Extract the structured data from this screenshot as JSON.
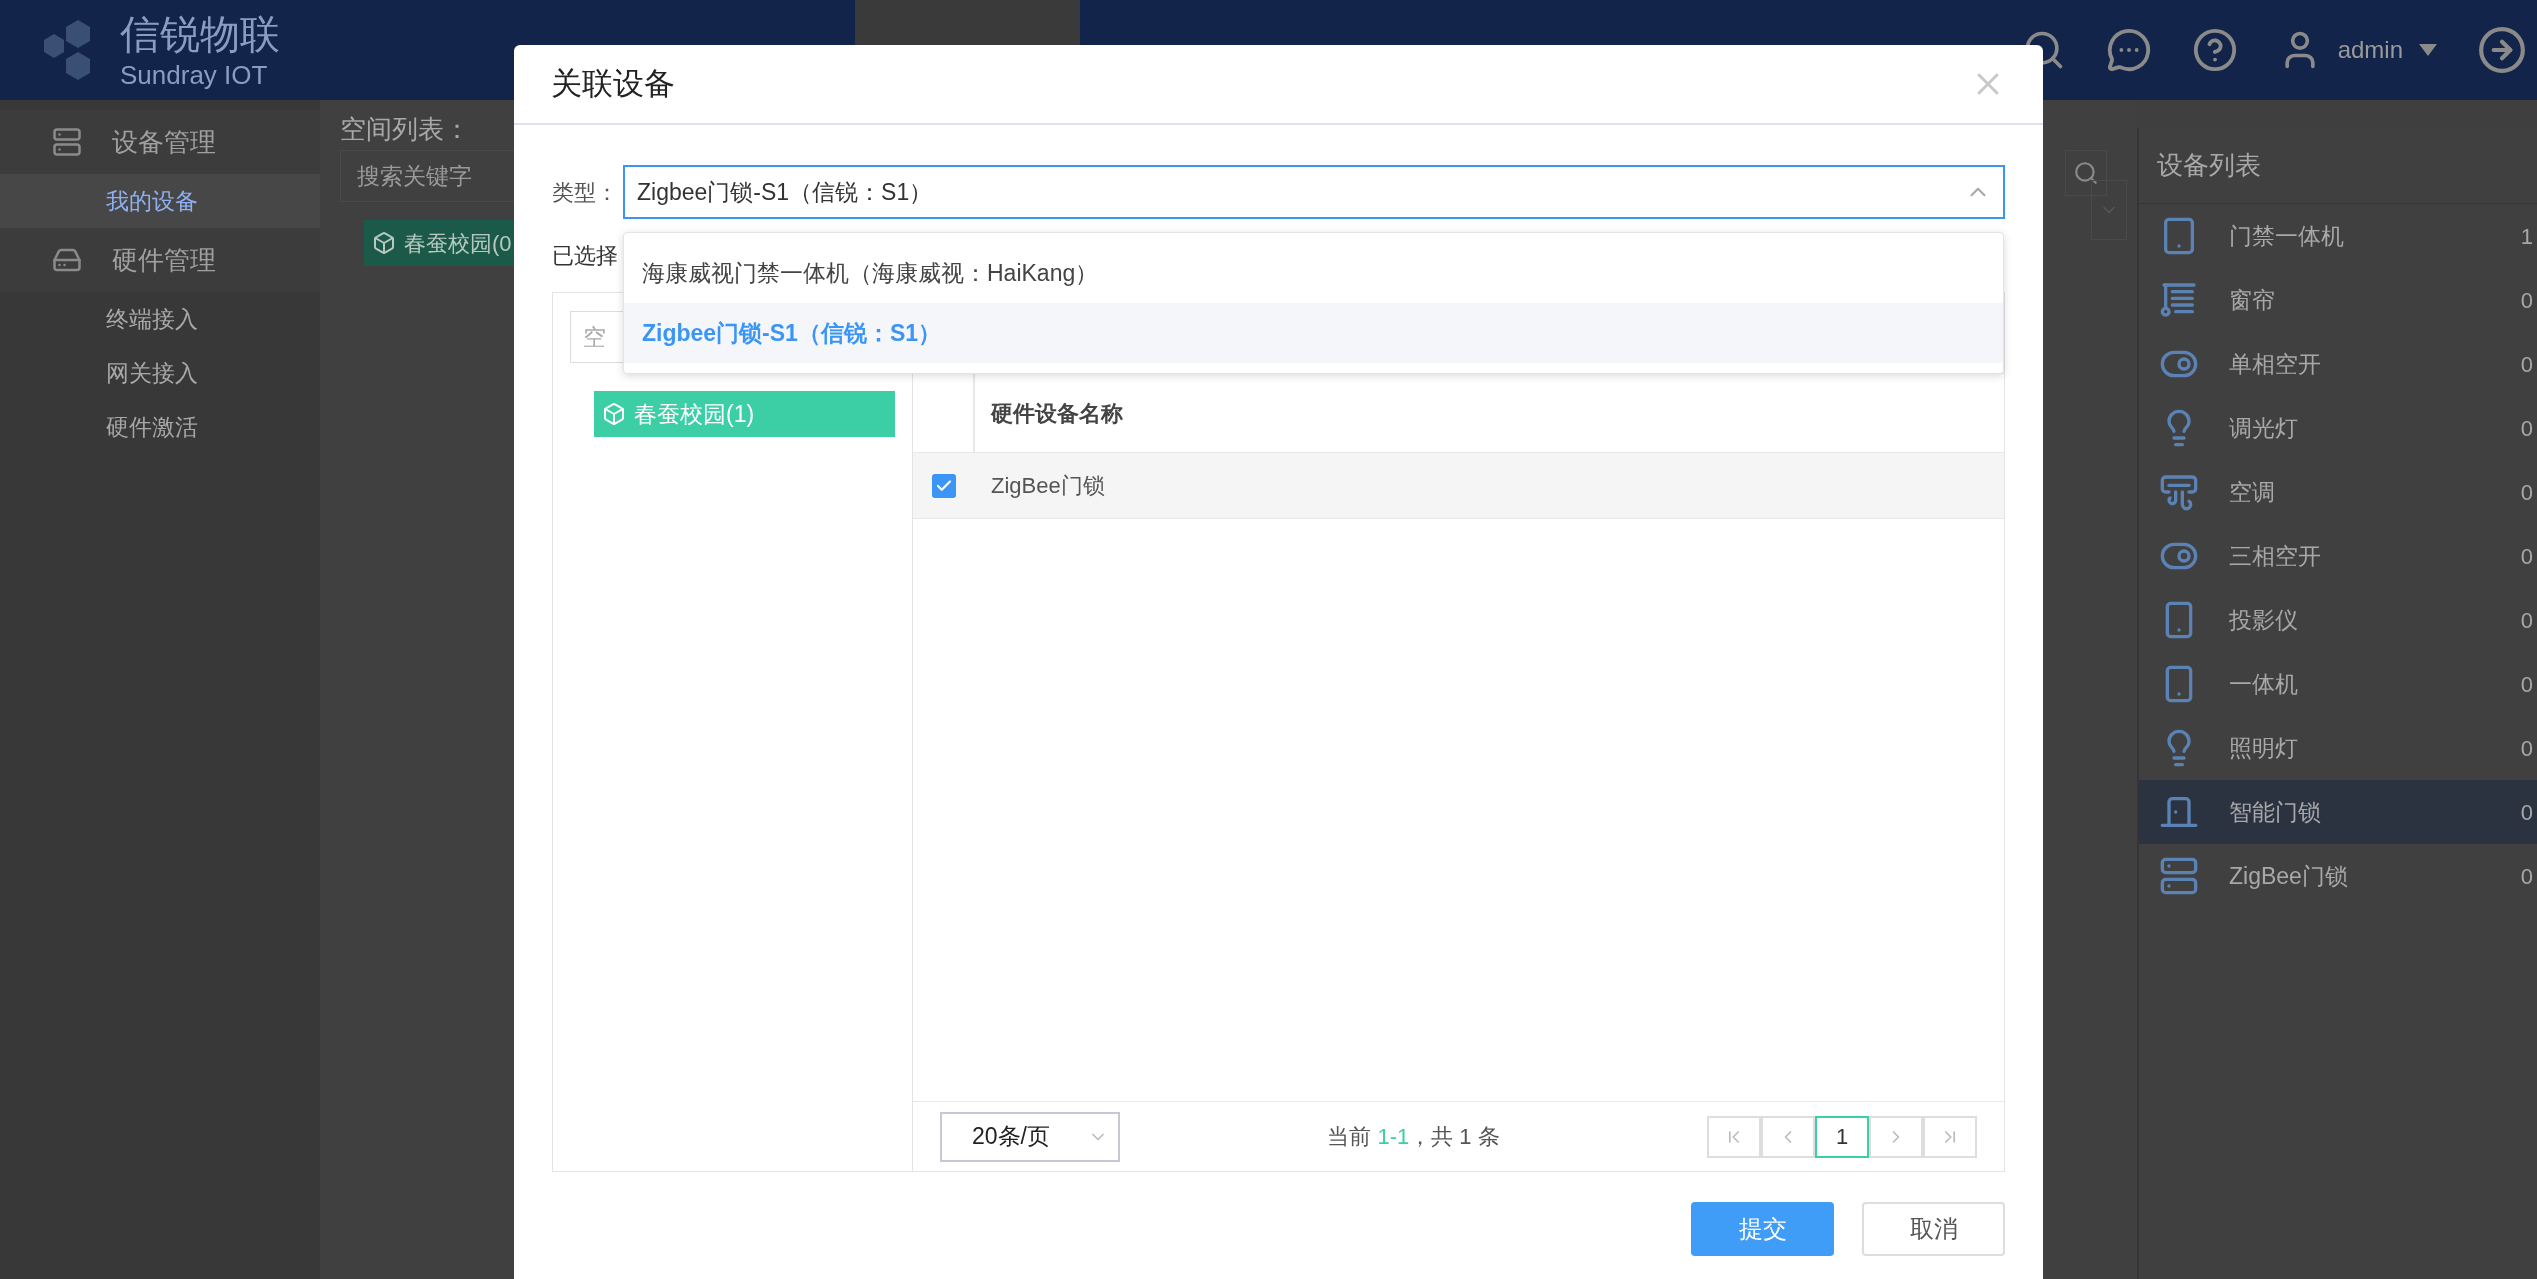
{
  "header": {
    "logo_title": "信锐物联",
    "logo_subtitle": "Sundray IOT",
    "user": "admin"
  },
  "sidebar": {
    "groups": [
      {
        "label": "设备管理",
        "kind": "devices",
        "items": [
          {
            "label": "我的设备",
            "selected": true
          }
        ]
      },
      {
        "label": "硬件管理",
        "kind": "hardware",
        "items": [
          {
            "label": "终端接入",
            "selected": false
          },
          {
            "label": "网关接入",
            "selected": false
          },
          {
            "label": "硬件激活",
            "selected": false
          }
        ]
      }
    ]
  },
  "space_panel": {
    "title": "空间列表：",
    "search": {
      "placeholder": "搜索关键字"
    },
    "node": "春蚕校园(0"
  },
  "device_list": {
    "title": "设备列表",
    "items": [
      {
        "name": "门禁一体机",
        "count": "1",
        "kind": "tablet",
        "selected": false
      },
      {
        "name": "窗帘",
        "count": "0",
        "kind": "curtain",
        "selected": false
      },
      {
        "name": "单相空开",
        "count": "0",
        "kind": "breaker",
        "selected": false
      },
      {
        "name": "调光灯",
        "count": "0",
        "kind": "bulb",
        "selected": false
      },
      {
        "name": "空调",
        "count": "0",
        "kind": "ac",
        "selected": false
      },
      {
        "name": "三相空开",
        "count": "0",
        "kind": "breaker",
        "selected": false
      },
      {
        "name": "投影仪",
        "count": "0",
        "kind": "panel",
        "selected": false
      },
      {
        "name": "一体机",
        "count": "0",
        "kind": "panel",
        "selected": false
      },
      {
        "name": "照明灯",
        "count": "0",
        "kind": "bulb",
        "selected": false
      },
      {
        "name": "智能门锁",
        "count": "0",
        "kind": "door",
        "selected": true
      },
      {
        "name": "ZigBee门锁",
        "count": "0",
        "kind": "rack",
        "selected": false
      }
    ]
  },
  "dialog": {
    "title": "关联设备",
    "type_label": "类型：",
    "type_value": "Zigbee门锁-S1（信锐：S1）",
    "expanded": true,
    "options": [
      {
        "label": "海康威视门禁一体机（海康威视：HaiKang）",
        "selected": false
      },
      {
        "label": "Zigbee门锁-S1（信锐：S1）",
        "selected": true
      }
    ],
    "selected_label": "已选择",
    "tree_search": {
      "placeholder": "空"
    },
    "tree_nodes": [
      {
        "label": "春蚕校园(1)",
        "selected": true
      }
    ],
    "table": {
      "columns": [
        "硬件设备名称"
      ],
      "rows": [
        {
          "name": "ZigBee门锁",
          "checked": true
        }
      ]
    },
    "pagination": {
      "page_size": "20条/页",
      "summary_prefix": "当前 ",
      "range": "1-1",
      "summary_suffix": "，共 1 条",
      "pages": [
        {
          "label": "1",
          "selected": true
        }
      ]
    },
    "buttons": [
      {
        "label": "提交",
        "kind": "primary"
      },
      {
        "label": "取消",
        "kind": "default"
      }
    ]
  }
}
